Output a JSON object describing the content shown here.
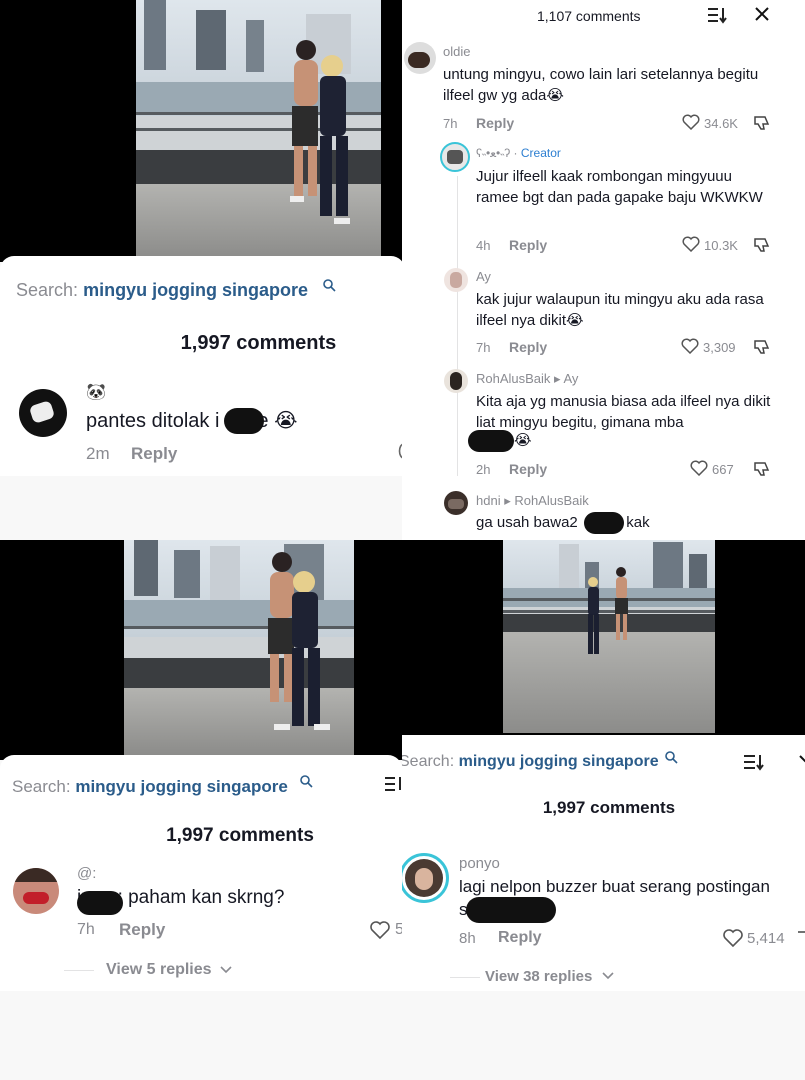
{
  "panel_tl": {
    "search_label": "Search:",
    "search_query": "mingyu jogging singapore",
    "comments_count": "1,997 comments",
    "comment": {
      "text_before": "pantes ditolak i",
      "text_after": "e",
      "emoji": "😭",
      "time": "2m",
      "reply_label": "Reply"
    }
  },
  "panel_tr": {
    "comments_count": "1,107 comments",
    "comments": [
      {
        "username": "oldie",
        "text": "untung mingyu, cowo lain lari setelannya begitu ilfeel gw yg ada😭",
        "time": "7h",
        "reply_label": "Reply",
        "likes": "34.6K"
      },
      {
        "username": "ʕ˵•ﻌ•˵ʔ",
        "creator_label": "Creator",
        "text": "Jujur ilfeell kaak rombongan mingyuuu ramee bgt dan pada gapake baju WKWKW",
        "time": "4h",
        "reply_label": "Reply",
        "likes": "10.3K"
      },
      {
        "username": "Ay",
        "text": "kak jujur walaupun itu mingyu aku ada rasa ilfeel nya dikit😭",
        "time": "7h",
        "reply_label": "Reply",
        "likes": "3,309"
      },
      {
        "username": "RohAlusBaik",
        "reply_to": "Ay",
        "text": "Kita aja yg manusia biasa ada ilfeel nya dikit liat mingyu begitu, gimana mba",
        "emoji": "😭",
        "time": "2h",
        "reply_label": "Reply",
        "likes": "667"
      },
      {
        "username": "hdni",
        "reply_to": "RohAlusBaik",
        "text_before": "ga usah bawa2",
        "text_after": "e kak"
      }
    ]
  },
  "panel_bl": {
    "search_label": "Search:",
    "search_query": "mingyu jogging singapore",
    "comments_count": "1,997 comments",
    "comment": {
      "username": "@:",
      "text_prefix": "ir",
      "text": ": paham kan skrng?",
      "time": "7h",
      "reply_label": "Reply",
      "likes": "5",
      "view_replies": "View 5 replies"
    }
  },
  "panel_br": {
    "search_label": "Search:",
    "search_query": "mingyu jogging singapore",
    "comments_count": "1,997 comments",
    "comment": {
      "username": "ponyo",
      "text_line1": "lagi nelpon buzzer buat serang postingan",
      "text_line2_prefix": "s",
      "time": "8h",
      "reply_label": "Reply",
      "likes": "5,414",
      "view_replies": "View 38 replies"
    }
  },
  "icons": [
    "search-icon",
    "sort-icon",
    "close-icon",
    "heart-icon",
    "dislike-icon",
    "chevron-down-icon",
    "play-triangle-icon"
  ],
  "colors": {
    "link": "#2b5c8a",
    "creator": "#2d7fd1",
    "muted": "#8a8b91",
    "text": "#161823"
  }
}
